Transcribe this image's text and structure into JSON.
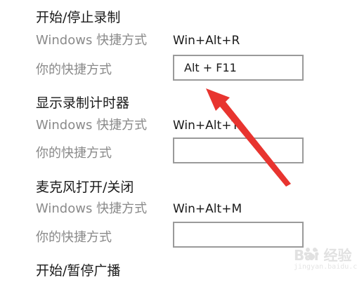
{
  "sections": [
    {
      "title": "开始/停止录制",
      "windows_label": "Windows 快捷方式",
      "windows_value": "Win+Alt+R",
      "custom_label": "你的快捷方式",
      "custom_value": "Alt + F11"
    },
    {
      "title": "显示录制计时器",
      "windows_label": "Windows 快捷方式",
      "windows_value": "Win+Alt+T",
      "custom_label": "你的快捷方式",
      "custom_value": ""
    },
    {
      "title": "麦克风打开/关闭",
      "windows_label": "Windows 快捷方式",
      "windows_value": "Win+Alt+M",
      "custom_label": "你的快捷方式",
      "custom_value": ""
    },
    {
      "title": "开始/暂停广播"
    }
  ],
  "annotation": {
    "arrow_color": "#e8342f"
  },
  "watermark": {
    "text": "Bai 经验",
    "sub": "jingyan.baidu.com"
  }
}
